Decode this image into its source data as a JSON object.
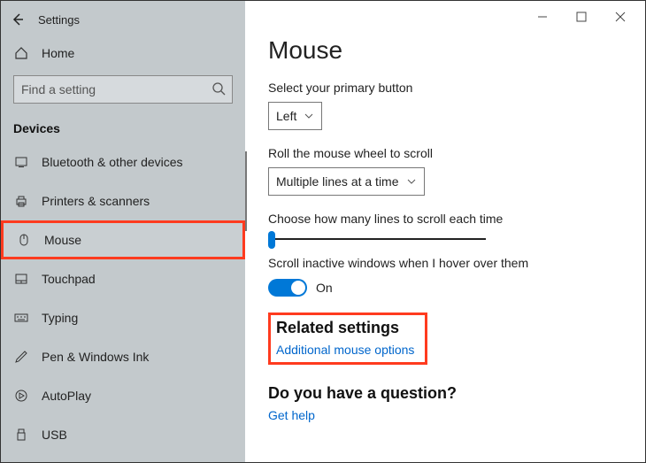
{
  "app": {
    "title": "Settings"
  },
  "sidebar": {
    "home_label": "Home",
    "search_placeholder": "Find a setting",
    "category": "Devices",
    "items": [
      {
        "label": "Bluetooth & other devices"
      },
      {
        "label": "Printers & scanners"
      },
      {
        "label": "Mouse"
      },
      {
        "label": "Touchpad"
      },
      {
        "label": "Typing"
      },
      {
        "label": "Pen & Windows Ink"
      },
      {
        "label": "AutoPlay"
      },
      {
        "label": "USB"
      }
    ]
  },
  "page": {
    "title": "Mouse",
    "primary_button_label": "Select your primary button",
    "primary_button_value": "Left",
    "scroll_wheel_label": "Roll the mouse wheel to scroll",
    "scroll_wheel_value": "Multiple lines at a time",
    "lines_label": "Choose how many lines to scroll each time",
    "inactive_label": "Scroll inactive windows when I hover over them",
    "inactive_state": "On",
    "related_heading": "Related settings",
    "related_link": "Additional mouse options",
    "question_heading": "Do you have a question?",
    "help_link": "Get help"
  }
}
